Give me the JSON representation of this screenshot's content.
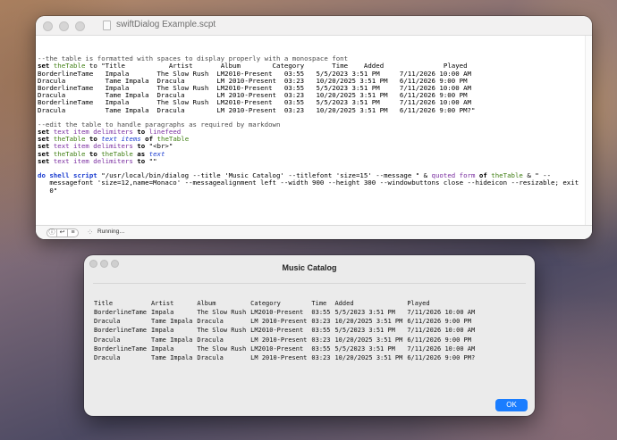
{
  "editor": {
    "title": "swiftDialog Example.scpt",
    "status": "Running…",
    "code_lines": [
      [],
      [
        {
          "t": "--the table is formatted with spaces to display properly with a monospace font",
          "c": "comment"
        }
      ],
      [
        {
          "t": "set ",
          "c": "kw"
        },
        {
          "t": "theTable",
          "c": "var"
        },
        {
          "t": " to \"Title           Artist       Album        Category       Time    Added               Played",
          "c": "str"
        }
      ],
      [
        {
          "t": "BorderlineTame   Impala       The Slow Rush  LM2010-Present   03:55   5/5/2023 3:51 PM     7/11/2026 10:00 AM",
          "c": "str"
        }
      ],
      [
        {
          "t": "Dracula          Tame Impala  Dracula        LM 2010-Present  03:23   10/20/2025 3:51 PM   6/11/2026 9:00 PM",
          "c": "str"
        }
      ],
      [
        {
          "t": "BorderlineTame   Impala       The Slow Rush  LM2010-Present   03:55   5/5/2023 3:51 PM     7/11/2026 10:00 AM",
          "c": "str"
        }
      ],
      [
        {
          "t": "Dracula          Tame Impala  Dracula        LM 2010-Present  03:23   10/20/2025 3:51 PM   6/11/2026 9:00 PM",
          "c": "str"
        }
      ],
      [
        {
          "t": "BorderlineTame   Impala       The Slow Rush  LM2010-Present   03:55   5/5/2023 3:51 PM     7/11/2026 10:00 AM",
          "c": "str"
        }
      ],
      [
        {
          "t": "Dracula          Tame Impala  Dracula        LM 2010-Present  03:23   10/20/2025 3:51 PM   6/11/2026 9:00 PM?\"",
          "c": "str"
        }
      ],
      [],
      [
        {
          "t": "--edit the table to handle paragraphs as required by markdown",
          "c": "comment"
        }
      ],
      [
        {
          "t": "set ",
          "c": "kw"
        },
        {
          "t": "text item delimiters",
          "c": "prop"
        },
        {
          "t": " to ",
          "c": "kw"
        },
        {
          "t": "linefeed",
          "c": "prop"
        }
      ],
      [
        {
          "t": "set ",
          "c": "kw"
        },
        {
          "t": "theTable",
          "c": "var"
        },
        {
          "t": " to ",
          "c": "kw"
        },
        {
          "t": "text items",
          "c": "cls"
        },
        {
          "t": " of ",
          "c": "kw"
        },
        {
          "t": "theTable",
          "c": "var"
        }
      ],
      [
        {
          "t": "set ",
          "c": "kw"
        },
        {
          "t": "text item delimiters",
          "c": "prop"
        },
        {
          "t": " to ",
          "c": "kw"
        },
        {
          "t": "\"<br>\"",
          "c": "str"
        }
      ],
      [
        {
          "t": "set ",
          "c": "kw"
        },
        {
          "t": "theTable",
          "c": "var"
        },
        {
          "t": " to ",
          "c": "kw"
        },
        {
          "t": "theTable",
          "c": "var"
        },
        {
          "t": " as ",
          "c": "kw"
        },
        {
          "t": "text",
          "c": "cls"
        }
      ],
      [
        {
          "t": "set ",
          "c": "kw"
        },
        {
          "t": "text item delimiters",
          "c": "prop"
        },
        {
          "t": " to ",
          "c": "kw"
        },
        {
          "t": "\"\"",
          "c": "str"
        }
      ],
      [],
      [
        {
          "t": "do shell script",
          "c": "cmd"
        },
        {
          "t": " \"/usr/local/bin/dialog --title 'Music Catalog' --titlefont 'size=15' --message \" & ",
          "c": "str"
        },
        {
          "t": "quoted form",
          "c": "prop"
        },
        {
          "t": " of ",
          "c": "kw"
        },
        {
          "t": "theTable",
          "c": "var"
        },
        {
          "t": " & \" --",
          "c": "str"
        }
      ],
      [
        {
          "t": "   messagefont 'size=12,name=Monaco' --messagealignment left --width 900 --height 300 --windowbuttons close --hideicon --resizable; exit",
          "c": "str"
        }
      ],
      [
        {
          "t": "   0\"",
          "c": "str"
        }
      ]
    ]
  },
  "dialog": {
    "title": "Music Catalog",
    "ok_label": "OK",
    "headers": [
      "Title",
      "Artist",
      "Album",
      "Category",
      "Time",
      "Added",
      "Played"
    ],
    "rows": [
      [
        "BorderlineTame",
        "Impala",
        "The Slow Rush",
        "LM2010-Present",
        "03:55",
        "5/5/2023 3:51 PM",
        "7/11/2026 10:00 AM"
      ],
      [
        "Dracula",
        "Tame Impala",
        "Dracula",
        "LM 2010-Present",
        "03:23",
        "10/20/2025 3:51 PM",
        "6/11/2026 9:00 PM"
      ],
      [
        "BorderlineTame",
        "Impala",
        "The Slow Rush",
        "LM2010-Present",
        "03:55",
        "5/5/2023 3:51 PM",
        "7/11/2026 10:00 AM"
      ],
      [
        "Dracula",
        "Tame Impala",
        "Dracula",
        "LM 2010-Present",
        "03:23",
        "10/20/2025 3:51 PM",
        "6/11/2026 9:00 PM"
      ],
      [
        "BorderlineTame",
        "Impala",
        "The Slow Rush",
        "LM2010-Present",
        "03:55",
        "5/5/2023 3:51 PM",
        "7/11/2026 10:00 AM"
      ],
      [
        "Dracula",
        "Tame Impala",
        "Dracula",
        "LM 2010-Present",
        "03:23",
        "10/20/2025 3:51 PM",
        "6/11/2026 9:00 PM?"
      ]
    ]
  },
  "colors": {
    "accent": "#1a7dff",
    "variable": "#3f7e12",
    "property": "#7a2ea0",
    "class": "#1c3ed0"
  }
}
